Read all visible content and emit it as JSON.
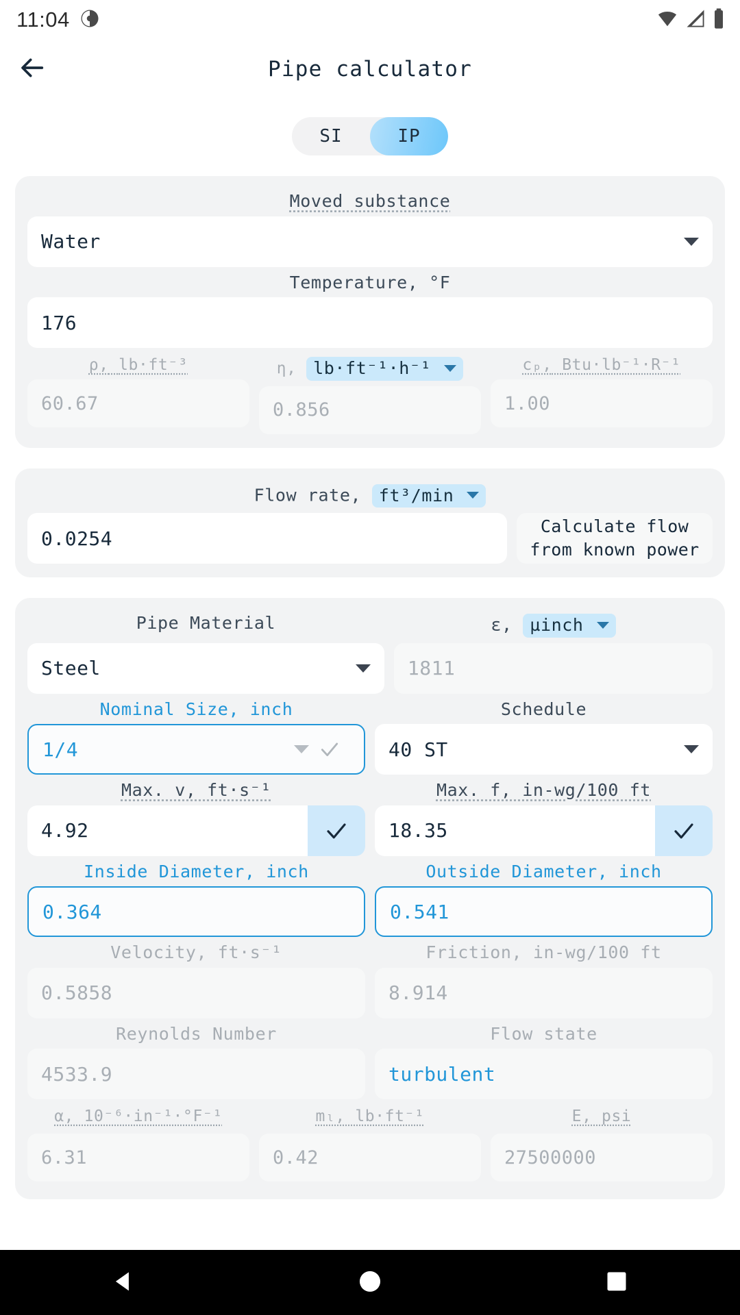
{
  "status_bar": {
    "time": "11:04",
    "clock_icon": "clock-icon",
    "wifi_icon": "wifi-icon",
    "signal_icon": "cellular-signal-icon",
    "battery_icon": "battery-icon"
  },
  "app_bar": {
    "back_icon": "back-arrow-icon",
    "title": "Pipe calculator"
  },
  "unit_toggle": {
    "options": [
      "SI",
      "IP"
    ],
    "selected": "IP"
  },
  "substance": {
    "label": "Moved substance",
    "value": "Water",
    "temperature_label": "Temperature, °F",
    "temperature_value": "176",
    "properties": [
      {
        "symbol": "ρ,",
        "unit": "lb·ft⁻³",
        "value": "60.67",
        "unit_selectable": false
      },
      {
        "symbol": "η,",
        "unit": "lb·ft⁻¹·h⁻¹",
        "value": "0.856",
        "unit_selectable": true
      },
      {
        "symbol": "cₚ,",
        "unit": "Btu·lb⁻¹·R⁻¹",
        "value": "1.00",
        "unit_selectable": false
      }
    ]
  },
  "flow": {
    "label": "Flow rate,",
    "unit": "ft³/min",
    "value": "0.0254",
    "calc_button": "Calculate flow from known power"
  },
  "pipe": {
    "material_label": "Pipe Material",
    "material_value": "Steel",
    "roughness_symbol": "ε,",
    "roughness_unit": "µinch",
    "roughness_value": "1811",
    "nominal_label": "Nominal Size, inch",
    "nominal_value": "1/4",
    "schedule_label": "Schedule",
    "schedule_value": "40 ST",
    "max_v_label": "Max. v, ft·s⁻¹",
    "max_v_value": "4.92",
    "max_f_label": "Max. f, in-wg/100 ft",
    "max_f_value": "18.35",
    "inside_d_label": "Inside Diameter, inch",
    "inside_d_value": "0.364",
    "outside_d_label": "Outside Diameter, inch",
    "outside_d_value": "0.541",
    "velocity_label": "Velocity, ft·s⁻¹",
    "velocity_value": "0.5858",
    "friction_label": "Friction, in-wg/100 ft",
    "friction_value": "8.914",
    "reynolds_label": "Reynolds Number",
    "reynolds_value": "4533.9",
    "flow_state_label": "Flow state",
    "flow_state_value": "turbulent",
    "alpha_label": "α, 10⁻⁶·in⁻¹·°F⁻¹",
    "alpha_value": "6.31",
    "mass_label": "mₗ, lb·ft⁻¹",
    "mass_value": "0.42",
    "modulus_label": "E, psi",
    "modulus_value": "27500000"
  },
  "nav_bar": {
    "back": "nav-back-icon",
    "home": "nav-home-icon",
    "recents": "nav-recents-icon"
  },
  "colors": {
    "accent": "#2196d8",
    "chip": "#cbe9fb",
    "card": "#f2f3f4",
    "text": "#17293a",
    "muted": "#a9afb5"
  }
}
